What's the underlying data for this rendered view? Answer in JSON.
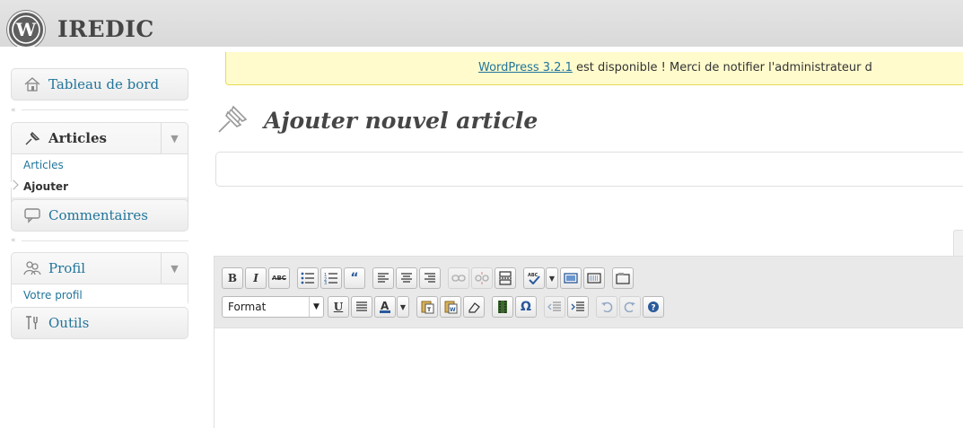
{
  "header": {
    "site_title": "IREDIC"
  },
  "sidebar": {
    "dashboard": "Tableau de bord",
    "articles": {
      "label": "Articles",
      "items": [
        "Articles",
        "Ajouter"
      ]
    },
    "comments": "Commentaires",
    "profile": {
      "label": "Profil",
      "items": [
        "Votre profil"
      ]
    },
    "tools": "Outils"
  },
  "notice": {
    "link": "WordPress 3.2.1",
    "text": " est disponible ! Merci de notifier l'administrateur d"
  },
  "page": {
    "title": "Ajouter nouvel article"
  },
  "editor": {
    "format_select": "Format",
    "row1_icons": [
      "bold-icon",
      "italic-icon",
      "strikethrough-icon",
      "bullet-list-icon",
      "numbered-list-icon",
      "blockquote-icon",
      "align-left-icon",
      "align-center-icon",
      "align-right-icon",
      "link-icon",
      "unlink-icon",
      "more-tag-icon",
      "spellcheck-icon",
      "fullscreen-icon",
      "kitchen-sink-icon",
      "insert-media-icon"
    ],
    "row2_icons": [
      "underline-icon",
      "justify-icon",
      "text-color-icon",
      "paste-text-icon",
      "paste-word-icon",
      "clear-formatting-icon",
      "insert-embed-icon",
      "special-char-icon",
      "outdent-icon",
      "indent-icon",
      "undo-icon",
      "redo-icon",
      "help-icon"
    ]
  },
  "colors": {
    "link": "#21759b",
    "notice_bg": "#fffbcc",
    "notice_border": "#e6db55"
  }
}
